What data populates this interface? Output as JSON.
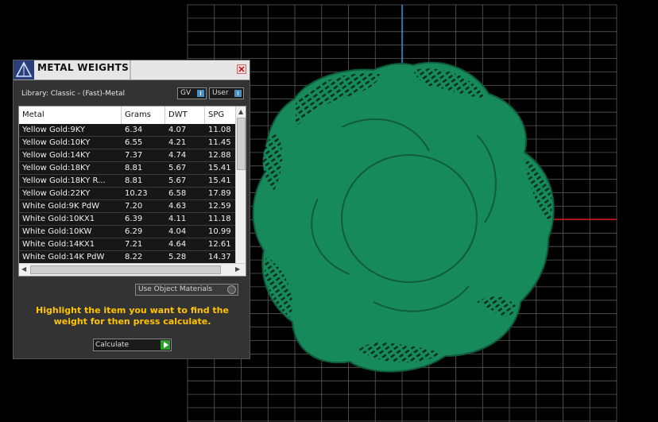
{
  "colors": {
    "background": "#000000",
    "grid": "#5a5a5a",
    "axis_x": "#d01818",
    "axis_y": "#2a9fd6",
    "model": "#178a5c",
    "hint_text": "#ffc400",
    "panel_bg": "#333333"
  },
  "viewport": {
    "object_name": "pendant-model"
  },
  "panel": {
    "title": "METAL WEIGHTS",
    "library_label": "Library: Classic - (Fast)-Metal",
    "gv_label": "GV",
    "user_label": "User",
    "table": {
      "headers": [
        "Metal",
        "Grams",
        "DWT",
        "SPG"
      ],
      "rows": [
        [
          "Yellow Gold:9KY",
          "6.34",
          "4.07",
          "11.08"
        ],
        [
          "Yellow Gold:10KY",
          "6.55",
          "4.21",
          "11.45"
        ],
        [
          "Yellow Gold:14KY",
          "7.37",
          "4.74",
          "12.88"
        ],
        [
          "Yellow Gold:18KY",
          "8.81",
          "5.67",
          "15.41"
        ],
        [
          "Yellow Gold:18KY R...",
          "8.81",
          "5.67",
          "15.41"
        ],
        [
          "Yellow Gold:22KY",
          "10.23",
          "6.58",
          "17.89"
        ],
        [
          "White Gold:9K PdW",
          "7.20",
          "4.63",
          "12.59"
        ],
        [
          "White Gold:10KX1",
          "6.39",
          "4.11",
          "11.18"
        ],
        [
          "White Gold:10KW",
          "6.29",
          "4.04",
          "10.99"
        ],
        [
          "White Gold:14KX1",
          "7.21",
          "4.64",
          "12.61"
        ],
        [
          "White Gold:14K PdW",
          "8.22",
          "5.28",
          "14.37"
        ]
      ]
    },
    "use_object_materials_label": "Use Object Materials",
    "hint_text": "Highlight the item you want to find the weight for then press calculate.",
    "calculate_label": "Calculate"
  }
}
